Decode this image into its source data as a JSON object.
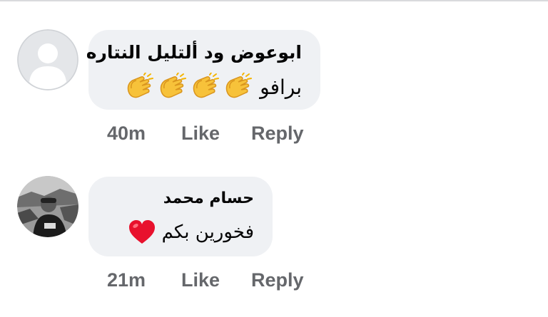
{
  "comments": [
    {
      "author": "ابوعوض ود ألتليل النتاره",
      "message_text": "برافو",
      "message_emoji": [
        "clapping-hands",
        "clapping-hands",
        "clapping-hands",
        "clapping-hands"
      ],
      "time": "40m",
      "like_label": "Like",
      "reply_label": "Reply",
      "avatar_type": "default-silhouette"
    },
    {
      "author": "حسام محمد",
      "message_text": "فخورين بكم",
      "message_emoji": [
        "red-heart"
      ],
      "time": "21m",
      "like_label": "Like",
      "reply_label": "Reply",
      "avatar_type": "photo"
    }
  ],
  "colors": {
    "bubble": "#eff1f4",
    "action_text": "#65676b",
    "text": "#050505",
    "heart": "#e8112d",
    "clap": "#f7c23a"
  }
}
